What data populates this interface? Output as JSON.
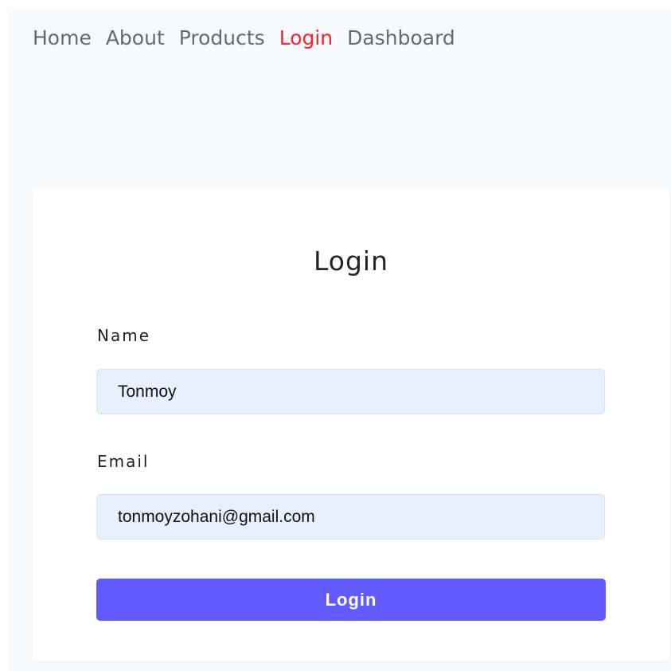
{
  "nav": {
    "items": [
      {
        "label": "Home",
        "active": false
      },
      {
        "label": "About",
        "active": false
      },
      {
        "label": "Products",
        "active": false
      },
      {
        "label": "Login",
        "active": true
      },
      {
        "label": "Dashboard",
        "active": false
      }
    ]
  },
  "login_form": {
    "title": "Login",
    "name_label": "Name",
    "name_value": "Tonmoy",
    "email_label": "Email",
    "email_value": "tonmoyzohani@gmail.com",
    "submit_label": "Login"
  },
  "colors": {
    "active_nav": "#ff1f2e",
    "button": "#625bff",
    "input_bg": "#e8f0fe",
    "page_bg": "#f8f9fb"
  }
}
